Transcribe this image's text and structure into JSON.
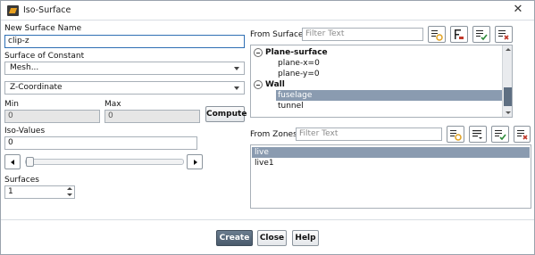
{
  "window": {
    "title": "Iso-Surface",
    "close_glyph": "✕"
  },
  "left": {
    "new_surface_name_label": "New Surface Name",
    "new_surface_name_value": "clip-z",
    "surface_of_constant_label": "Surface of Constant",
    "constant_category": "Mesh...",
    "constant_field": "Z-Coordinate",
    "min_label": "Min",
    "max_label": "Max",
    "min_value": "0",
    "max_value": "0",
    "compute_label": "Compute",
    "iso_values_label": "Iso-Values",
    "iso_value": "0",
    "slider_position": 0.0,
    "surfaces_label": "Surfaces",
    "surfaces_value": "1"
  },
  "from_surface": {
    "label": "From Surface",
    "filter_placeholder": "Filter Text",
    "groups": [
      {
        "name": "Plane-surface",
        "items": [
          "plane-x=0",
          "plane-y=0"
        ]
      },
      {
        "name": "Wall",
        "items": [
          "fuselage",
          "tunnel"
        ]
      }
    ],
    "selected_item": "fuselage"
  },
  "from_zones": {
    "label": "From Zones",
    "filter_placeholder": "Filter Text",
    "items": [
      "live",
      "live1"
    ],
    "selected_item": "live"
  },
  "footer": {
    "create_label": "Create",
    "close_label": "Close",
    "help_label": "Help"
  },
  "colors": {
    "selection": "#8a9bb0",
    "primary_button": "#5a6b7c",
    "scroll_thumb": "#5e6f82",
    "accent_yellow": "#e0a020",
    "accent_red": "#c0392b",
    "accent_green": "#2e8b3a"
  },
  "icons": [
    "select-all-icon",
    "deselect-all-icon",
    "filter-options-icon",
    "clear-selection-icon"
  ]
}
